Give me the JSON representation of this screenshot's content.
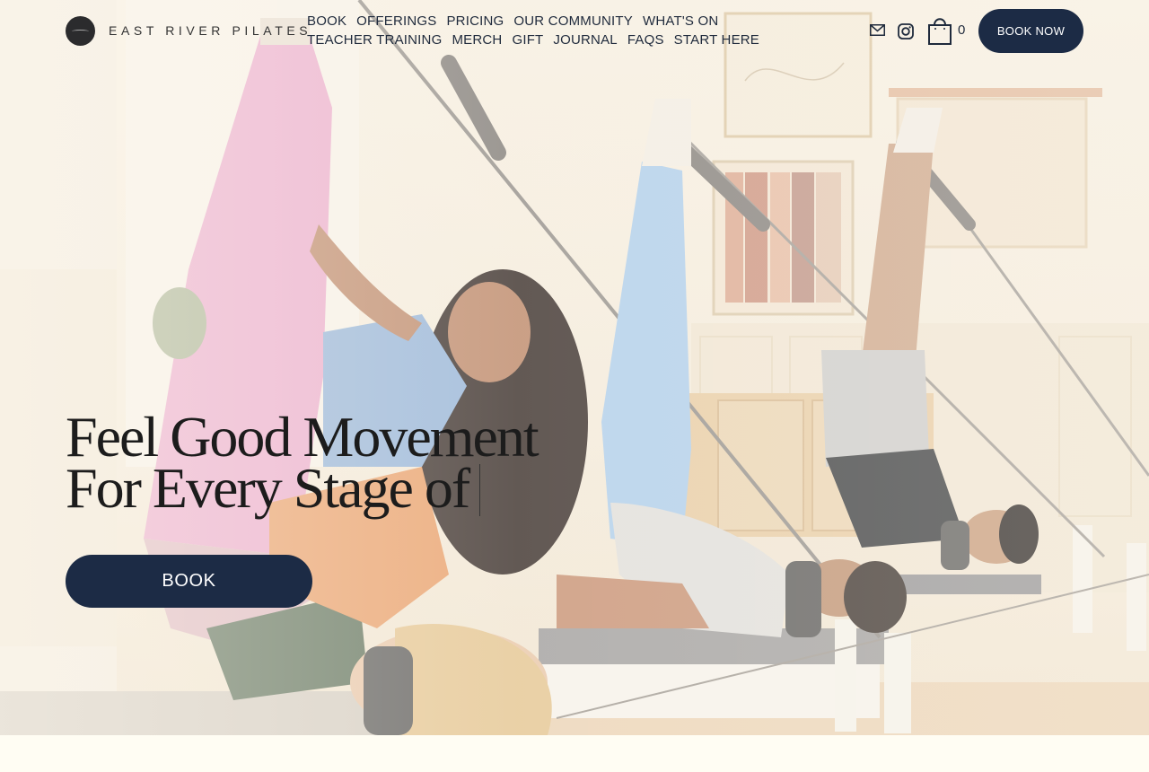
{
  "brand": {
    "name": "EAST RIVER PILATES"
  },
  "nav": {
    "items": [
      "BOOK",
      "OFFERINGS",
      "PRICING",
      "OUR COMMUNITY",
      "WHAT'S ON",
      "TEACHER TRAINING",
      "MERCH",
      "GIFT",
      "JOURNAL",
      "FAQS",
      "START HERE"
    ]
  },
  "header_icons": [
    "mail-icon",
    "instagram-icon",
    "shopping-bag-icon"
  ],
  "cart": {
    "count": "0"
  },
  "cta": {
    "book_now": "BOOK NOW",
    "book": "BOOK"
  },
  "hero": {
    "line1": "Feel Good Movement",
    "line2": "For Every Stage of"
  },
  "colors": {
    "navy": "#1c2b45",
    "background": "#fffdf3",
    "text": "#1f2a3c"
  }
}
